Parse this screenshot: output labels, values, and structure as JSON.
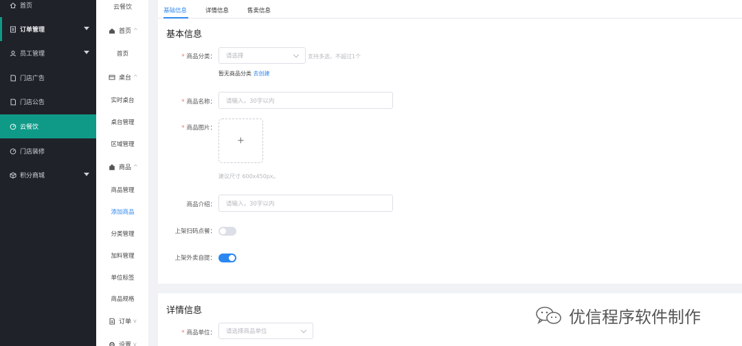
{
  "sidebar": {
    "items": [
      {
        "label": "首页",
        "icon": "home-icon"
      },
      {
        "label": "订单管理",
        "icon": "list-icon"
      },
      {
        "label": "员工管理",
        "icon": "user-icon"
      },
      {
        "label": "门店广告",
        "icon": "doc-icon"
      },
      {
        "label": "门店公告",
        "icon": "doc-icon"
      },
      {
        "label": "云餐饮",
        "icon": "gauge-icon"
      },
      {
        "label": "门店装修",
        "icon": "gauge-icon"
      },
      {
        "label": "积分商城",
        "icon": "box-icon"
      }
    ],
    "accent": "#0f9a87",
    "background": "#1f2329"
  },
  "submenu": {
    "title": "云餐饮",
    "groups": [
      {
        "label": "首页",
        "icon": "home-icon"
      },
      {
        "label": "桌台",
        "icon": "table-icon"
      },
      {
        "label": "商品",
        "icon": "bag-icon"
      },
      {
        "label": "订单",
        "icon": "doc-icon"
      },
      {
        "label": "设置",
        "icon": "gear-icon"
      }
    ],
    "links": {
      "home": "首页",
      "realtime_table": "实时桌台",
      "table_manage": "桌台管理",
      "area_manage": "区域管理",
      "goods_manage": "商品管理",
      "add_goods": "添加商品",
      "category_manage": "分类管理",
      "addon_manage": "加料管理",
      "unit_tag": "单位标签",
      "goods_spec": "商品规格"
    }
  },
  "tabs": [
    "基础信息",
    "详情信息",
    "售卖信息"
  ],
  "basic": {
    "title": "基本信息",
    "category": {
      "label": "商品分类：",
      "placeholder": "请选择",
      "hint": "支持多选，不超过1个",
      "note": "暂无商品分类",
      "note_link": "去创建"
    },
    "name": {
      "label": "商品名称：",
      "placeholder": "请输入，30字以内"
    },
    "image": {
      "label": "商品图片：",
      "plus": "+",
      "hint": "建议尺寸 600x450px。"
    },
    "intro": {
      "label": "商品介绍：",
      "placeholder": "请输入，30字以内"
    },
    "scan_order": {
      "label": "上架扫码点餐：",
      "on": false
    },
    "takeaway": {
      "label": "上架外卖自提：",
      "on": true
    }
  },
  "detail": {
    "title": "详情信息",
    "unit": {
      "label": "商品单位：",
      "placeholder": "请选择商品单位"
    }
  },
  "watermark": {
    "text": "优信程序软件制作"
  },
  "colors": {
    "primary": "#2b87f0",
    "required": "#f56c6c"
  }
}
